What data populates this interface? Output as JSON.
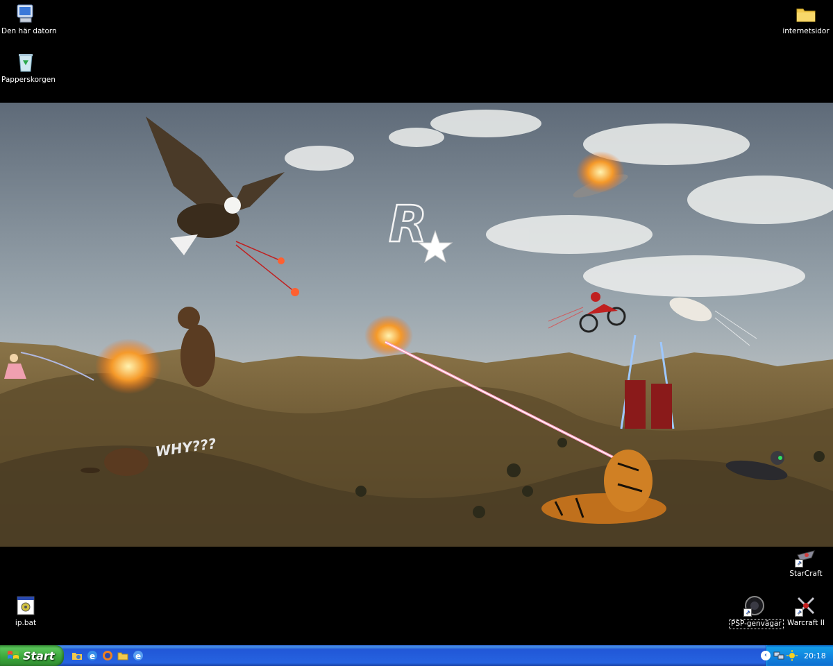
{
  "desktop": {
    "icons": [
      {
        "label": "Den här datorn"
      },
      {
        "label": "Papperskorgen"
      },
      {
        "label": "internetsidor"
      },
      {
        "label": "StarCraft"
      },
      {
        "label": "ip.bat"
      },
      {
        "label": "PSP-genvägar"
      },
      {
        "label": "Warcraft II"
      }
    ]
  },
  "wallpaper": {
    "caption": "WHY???"
  },
  "taskbar": {
    "start_label": "Start",
    "quick_launch": [
      "explorer-icon",
      "internet-explorer-icon",
      "firefox-icon",
      "folder-icon",
      "ie-alt-icon"
    ],
    "tray": {
      "clock": "20:18",
      "icons": [
        "show-hidden-icons-chevron",
        "network-icon",
        "sun-icon"
      ]
    }
  },
  "colors": {
    "taskbar": "#2663e0",
    "start": "#3aa63a",
    "tray": "#1187e0"
  }
}
